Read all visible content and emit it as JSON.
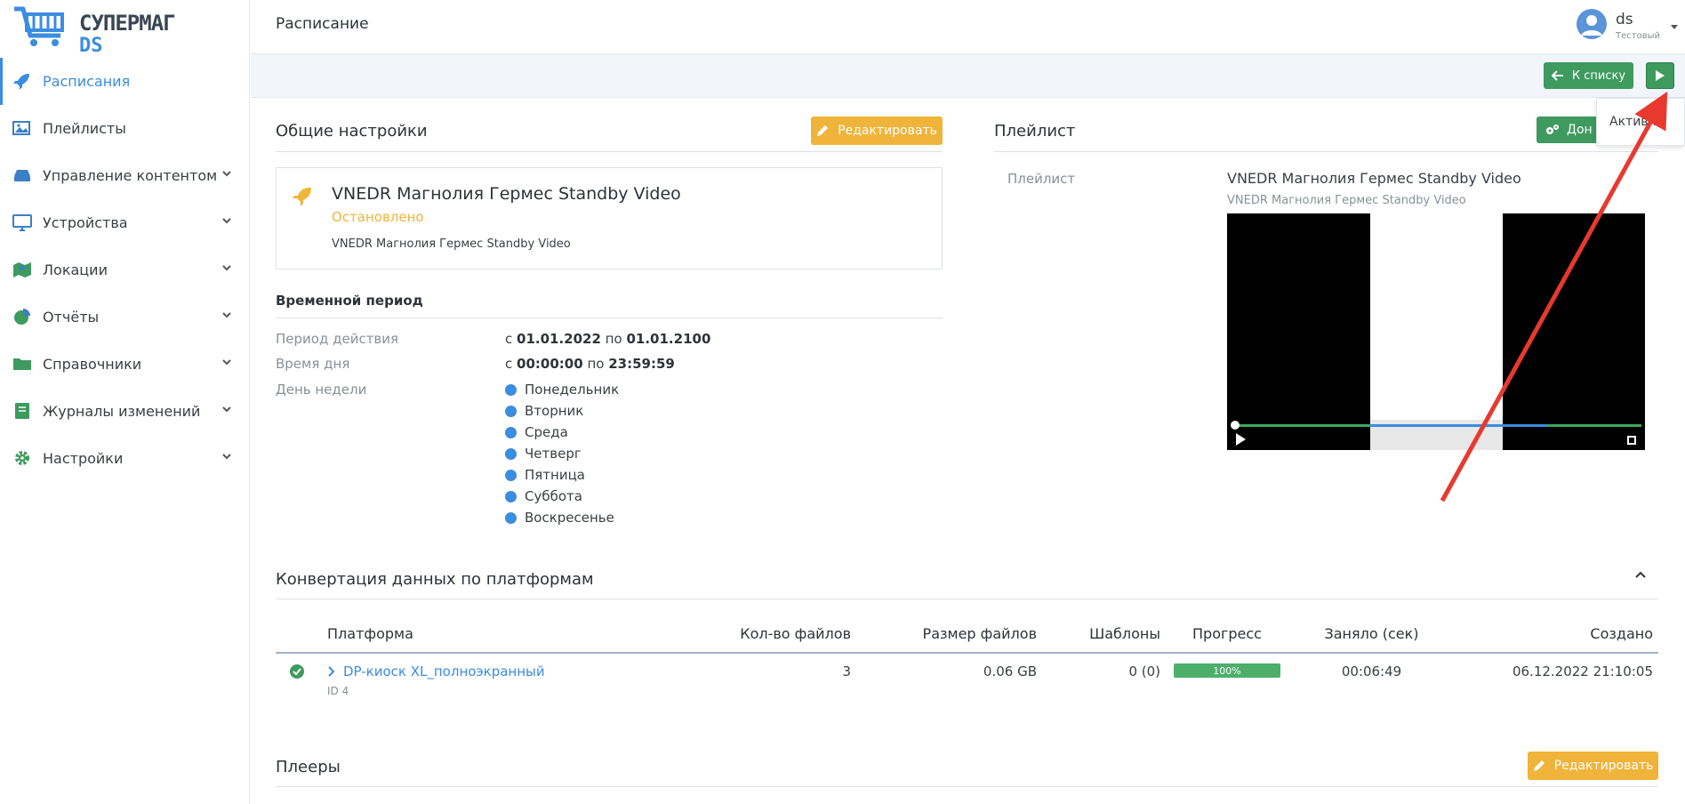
{
  "app": {
    "logo_line1": "СУПЕРМАГ",
    "logo_line2": "DS"
  },
  "sidebar": {
    "items": [
      {
        "label": "Расписания",
        "icon": "rocket-icon",
        "active": true
      },
      {
        "label": "Плейлисты",
        "icon": "images-icon"
      },
      {
        "label": "Управление контентом",
        "icon": "drive-icon"
      },
      {
        "label": "Устройства",
        "icon": "monitor-icon"
      },
      {
        "label": "Локации",
        "icon": "map-icon"
      },
      {
        "label": "Отчёты",
        "icon": "pie-chart-icon"
      },
      {
        "label": "Справочники",
        "icon": "folder-icon"
      },
      {
        "label": "Журналы изменений",
        "icon": "book-icon"
      },
      {
        "label": "Настройки",
        "icon": "gear-icon"
      }
    ]
  },
  "header": {
    "title": "Расписание",
    "user_name": "ds",
    "user_sub": "Тестовый"
  },
  "toolbar": {
    "back_label": "К списку",
    "dropdown_item": "Активно"
  },
  "general": {
    "title": "Общие настройки",
    "edit_label": "Редактировать",
    "schedule_name": "VNEDR Магнолия Гермес Standby Video",
    "status": "Остановлено",
    "playlist_name": "VNEDR Магнолия Гермес Standby Video"
  },
  "period": {
    "title": "Временной период",
    "validity_label": "Период действия",
    "validity_from_prefix": "с",
    "validity_from": "01.01.2022",
    "validity_to_prefix": "по",
    "validity_to": "01.01.2100",
    "time_label": "Время дня",
    "time_from_prefix": "с",
    "time_from": "00:00:00",
    "time_to_prefix": "по",
    "time_to": "23:59:59",
    "weekday_label": "День недели",
    "days": [
      "Понедельник",
      "Вторник",
      "Среда",
      "Четверг",
      "Пятница",
      "Суббота",
      "Воскресенье"
    ]
  },
  "playlist_panel": {
    "title": "Плейлист",
    "button_label": "Дон",
    "label": "Плейлист",
    "name": "VNEDR Магнолия Гермес Standby Video",
    "sub": "VNEDR Магнолия Гермес Standby Video"
  },
  "conversion": {
    "title": "Конвертация данных по платформам",
    "columns": [
      "Платформа",
      "Кол-во файлов",
      "Размер файлов",
      "Шаблоны",
      "Прогресс",
      "Заняло (сек)",
      "Создано"
    ],
    "row": {
      "platform": "DP-киоск XL_полноэкранный",
      "id": "ID 4",
      "files": "3",
      "size": "0.06 GB",
      "templates": "0 (0)",
      "progress": "100%",
      "progress_value": 1.0,
      "took": "00:06:49",
      "created": "06.12.2022 21:10:05"
    }
  },
  "players": {
    "title": "Плееры",
    "edit_label": "Редактировать"
  },
  "colors": {
    "accent": "#3b8ddf",
    "green": "#3e9a5e",
    "yellow": "#f0b43a",
    "annotation": "#e8392f"
  }
}
